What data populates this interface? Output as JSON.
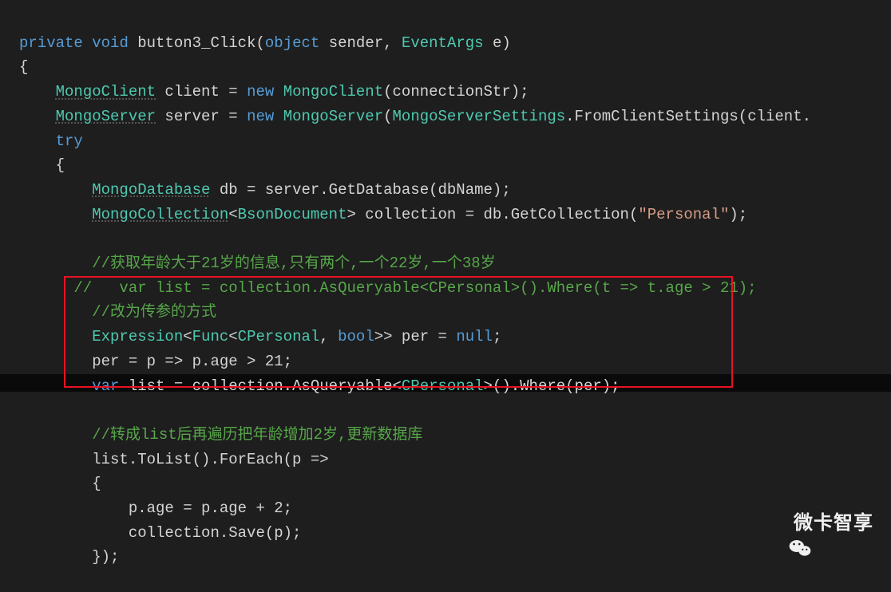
{
  "code": {
    "l1": {
      "t1": "private",
      "t2": "void",
      "t3": "button3_Click(",
      "t4": "object",
      "t5": " sender, ",
      "t6": "EventArgs",
      "t7": " e)"
    },
    "l2": "{",
    "l3": {
      "t1": "MongoClient",
      "t2": " client = ",
      "t3": "new",
      "t4": " ",
      "t5": "MongoClient",
      "t6": "(connectionStr);"
    },
    "l4": {
      "t1": "MongoServer",
      "t2": " server = ",
      "t3": "new",
      "t4": " ",
      "t5": "MongoServer",
      "t6": "(",
      "t7": "MongoServerSettings",
      "t8": ".FromClientSettings(client."
    },
    "l5": "try",
    "l6": "{",
    "l7": {
      "t1": "MongoDatabase",
      "t2": " db = server.GetDatabase(dbName);"
    },
    "l8": {
      "t1": "MongoCollection",
      "t2": "<",
      "t3": "BsonDocument",
      "t4": "> collection = db.GetCollection(",
      "t5": "\"Personal\"",
      "t6": ");"
    },
    "l9": "//获取年龄大于21岁的信息,只有两个,一个22岁,一个38岁",
    "l10": "//   var list = collection.AsQueryable<CPersonal>().Where(t => t.age > 21);",
    "l11": "//改为传参的方式",
    "l12": {
      "t1": "Expression",
      "t2": "<",
      "t3": "Func",
      "t4": "<",
      "t5": "CPersonal",
      "t6": ", ",
      "t7": "bool",
      "t8": ">> per = ",
      "t9": "null",
      "t10": ";"
    },
    "l13": "per = p => p.age > 21;",
    "l14": {
      "t1": "var",
      "t2": " list = collection.AsQueryable<",
      "t3": "CPersonal",
      "t4": ">().Where(per);"
    },
    "l15": "//转成list后再遍历把年龄增加2岁,更新数据库",
    "l16": "list.ToList().ForEach(p =>",
    "l17": "{",
    "l18": "p.age = p.age + 2;",
    "l19": "collection.Save(p);",
    "l20": "}); "
  },
  "watermark": "微卡智享"
}
